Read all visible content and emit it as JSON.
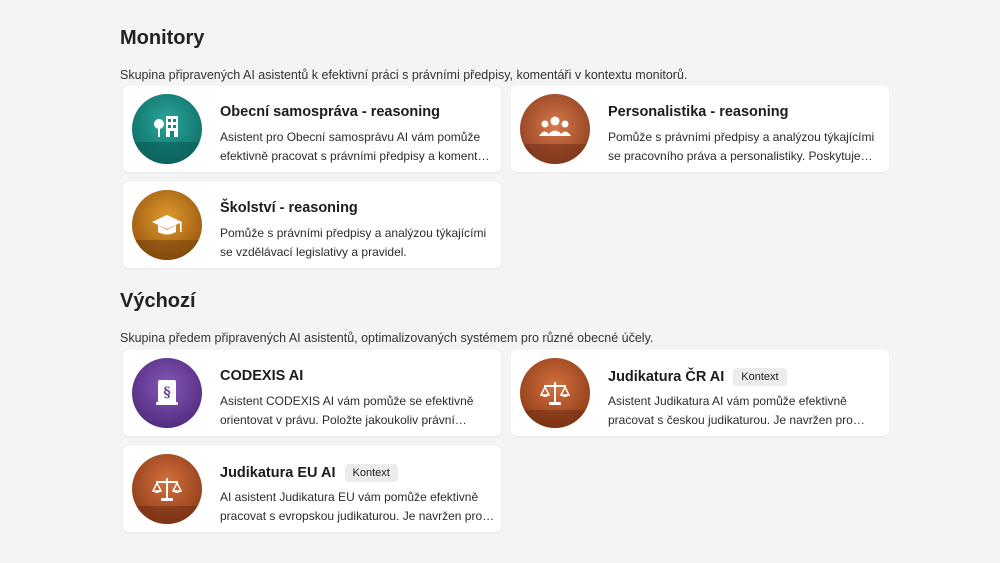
{
  "sections": [
    {
      "title": "Monitory",
      "description": "Skupina připravených AI asistentů k efektivní práci s právními předpisy, komentáři v kontextu monitorů.",
      "cards": [
        {
          "title": "Obecní samospráva - reasoning",
          "description": "Asistent pro Obecní samosprávu AI vám pomůže efektivně pracovat s právními předpisy a komentáři v kontextu monitoru obecní samosprávy.",
          "icon": "municipality-icon",
          "color": "#16857d"
        },
        {
          "title": "Personalistika - reasoning",
          "description": "Pomůže s právními předpisy a analýzou týkajícími se pracovního práva a personalistiky. Poskytuje odpovědi.",
          "icon": "people-group-icon",
          "color": "#b85a32"
        },
        {
          "title": "Školství - reasoning",
          "description": "Pomůže s právními předpisy a analýzou týkajícími se vzdělávací legislativy a pravidel.",
          "icon": "graduation-cap-icon",
          "color": "#c98218"
        }
      ]
    },
    {
      "title": "Výchozí",
      "description": "Skupina předem připravených AI asistentů, optimalizovaných systémem pro různé obecné účely.",
      "cards": [
        {
          "title": "CODEXIS AI",
          "description": "Asistent CODEXIS AI vám pomůže se efektivně orientovat v právu. Položte jakoukoliv právní otázku.",
          "icon": "law-book-icon",
          "color": "#6a3f9c"
        },
        {
          "title": "Judikatura ČR AI",
          "badge": "Kontext",
          "description": "Asistent Judikatura AI vám pomůže efektivně pracovat s českou judikaturou. Je navržen pro práci.",
          "icon": "scales-icon",
          "color": "#b9512a"
        },
        {
          "title": "Judikatura EU AI",
          "badge": "Kontext",
          "description": "AI asistent Judikatura EU vám pomůže efektivně pracovat s evropskou judikaturou. Je navržen pro práci.",
          "icon": "scales-icon",
          "color": "#b9512a"
        }
      ]
    }
  ]
}
